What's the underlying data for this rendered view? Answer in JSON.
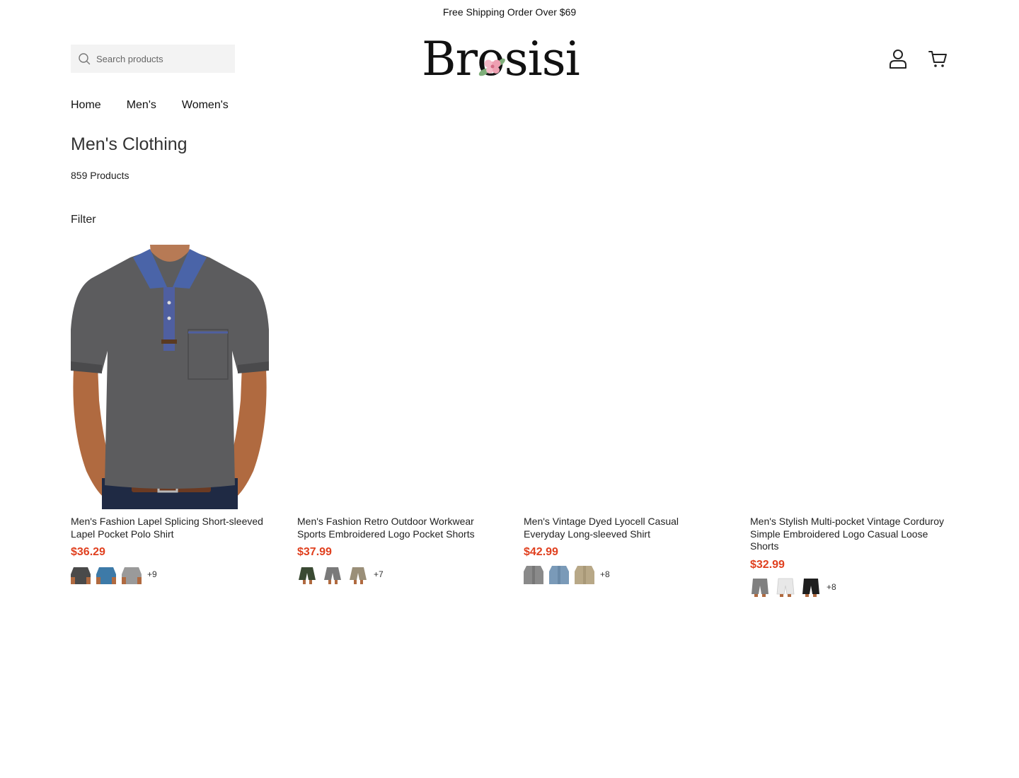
{
  "announcement": "Free Shipping Order Over $69",
  "search": {
    "placeholder": "Search products"
  },
  "logo": {
    "text": "Brosisi"
  },
  "nav": [
    "Home",
    "Men's",
    "Women's"
  ],
  "page": {
    "title": "Men's Clothing",
    "product_count": "859 Products",
    "filter_label": "Filter"
  },
  "colors": {
    "price": "#e0401f",
    "search_bg": "#f3f3f3"
  },
  "products": [
    {
      "title": "Men's Fashion Lapel Splicing Short-sleeved Lapel Pocket Polo Shirt",
      "price": "$36.29",
      "more_colors": "+9",
      "swatches": [
        "#4a4a4a",
        "#3d7aa8",
        "#9a9a9a"
      ]
    },
    {
      "title": " Men's Fashion Retro Outdoor Workwear Sports Embroidered Logo Pocket Shorts",
      "price": "$37.99",
      "more_colors": "+7",
      "swatches": [
        "#3a4a33",
        "#7a7a7a",
        "#9a8f78"
      ]
    },
    {
      "title": "Men's Vintage Dyed Lyocell Casual Everyday Long-sleeved Shirt",
      "price": "$42.99",
      "more_colors": "+8",
      "swatches": [
        "#8a8a8a",
        "#7a9ab8",
        "#b8a887"
      ]
    },
    {
      "title": "Men's Stylish Multi-pocket Vintage Corduroy Simple Embroidered Logo Casual Loose Shorts",
      "price": "$32.99",
      "more_colors": "+8",
      "swatches": [
        "#808080",
        "#e8e8e8",
        "#1e1e1e"
      ]
    }
  ]
}
